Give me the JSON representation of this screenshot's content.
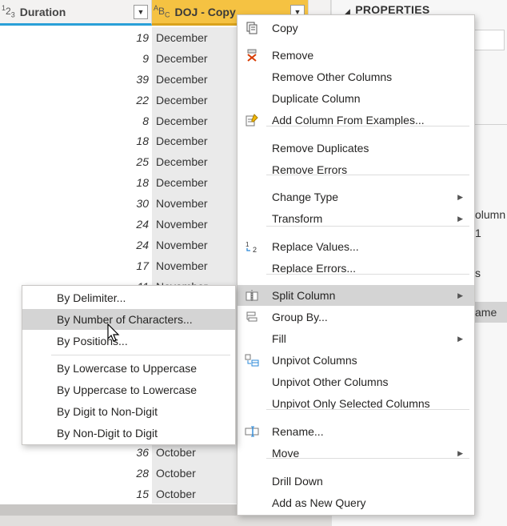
{
  "grid": {
    "col_duration": {
      "label": "Duration",
      "type_icon": "1 2 3"
    },
    "col_doj": {
      "label": "DOJ - Copy",
      "type_icon": "A B C"
    },
    "rows": [
      {
        "num": "19",
        "month": "December"
      },
      {
        "num": "9",
        "month": "December"
      },
      {
        "num": "39",
        "month": "December"
      },
      {
        "num": "22",
        "month": "December"
      },
      {
        "num": "8",
        "month": "December"
      },
      {
        "num": "18",
        "month": "December"
      },
      {
        "num": "25",
        "month": "December"
      },
      {
        "num": "18",
        "month": "December"
      },
      {
        "num": "30",
        "month": "November"
      },
      {
        "num": "24",
        "month": "November"
      },
      {
        "num": "24",
        "month": "November"
      },
      {
        "num": "17",
        "month": "November"
      },
      {
        "num": "11",
        "month": "November"
      },
      {
        "num": "",
        "month": ""
      },
      {
        "num": "",
        "month": ""
      },
      {
        "num": "",
        "month": ""
      },
      {
        "num": "",
        "month": ""
      },
      {
        "num": "",
        "month": ""
      },
      {
        "num": "",
        "month": ""
      },
      {
        "num": "",
        "month": ""
      },
      {
        "num": "36",
        "month": "October"
      },
      {
        "num": "28",
        "month": "October"
      },
      {
        "num": "15",
        "month": "October"
      }
    ]
  },
  "properties": {
    "title": "PROPERTIES",
    "frag_column": "olumn",
    "frag_1": "1",
    "frag_s": "s",
    "frag_ame": "ame"
  },
  "menu": {
    "items": [
      {
        "label": "Copy",
        "icon": "copy-icon"
      },
      {
        "label": "Remove",
        "icon": "remove-icon"
      },
      {
        "label": "Remove Other Columns"
      },
      {
        "label": "Duplicate Column"
      },
      {
        "label": "Add Column From Examples...",
        "icon": "add-examples-icon"
      },
      {
        "label": "Remove Duplicates"
      },
      {
        "label": "Remove Errors"
      },
      {
        "label": "Change Type",
        "submenu": true
      },
      {
        "label": "Transform",
        "submenu": true
      },
      {
        "label": "Replace Values...",
        "icon": "replace-values-icon"
      },
      {
        "label": "Replace Errors..."
      },
      {
        "label": "Split Column",
        "icon": "split-column-icon",
        "submenu": true,
        "highlighted": true
      },
      {
        "label": "Group By...",
        "icon": "group-by-icon"
      },
      {
        "label": "Fill",
        "submenu": true
      },
      {
        "label": "Unpivot Columns",
        "icon": "unpivot-icon"
      },
      {
        "label": "Unpivot Other Columns"
      },
      {
        "label": "Unpivot Only Selected Columns"
      },
      {
        "label": "Rename...",
        "icon": "rename-icon"
      },
      {
        "label": "Move",
        "submenu": true
      },
      {
        "label": "Drill Down"
      },
      {
        "label": "Add as New Query"
      }
    ]
  },
  "submenu": {
    "items": [
      {
        "label": "By Delimiter..."
      },
      {
        "label": "By Number of Characters...",
        "highlighted": true
      },
      {
        "label": "By Positions..."
      },
      {
        "label": "By Lowercase to Uppercase"
      },
      {
        "label": "By Uppercase to Lowercase"
      },
      {
        "label": "By Digit to Non-Digit"
      },
      {
        "label": "By Non-Digit to Digit"
      }
    ]
  },
  "colors": {
    "header_accent": "#f5c242",
    "selected_column_bg": "#eaeaea",
    "menu_highlight": "#d4d4d4"
  }
}
